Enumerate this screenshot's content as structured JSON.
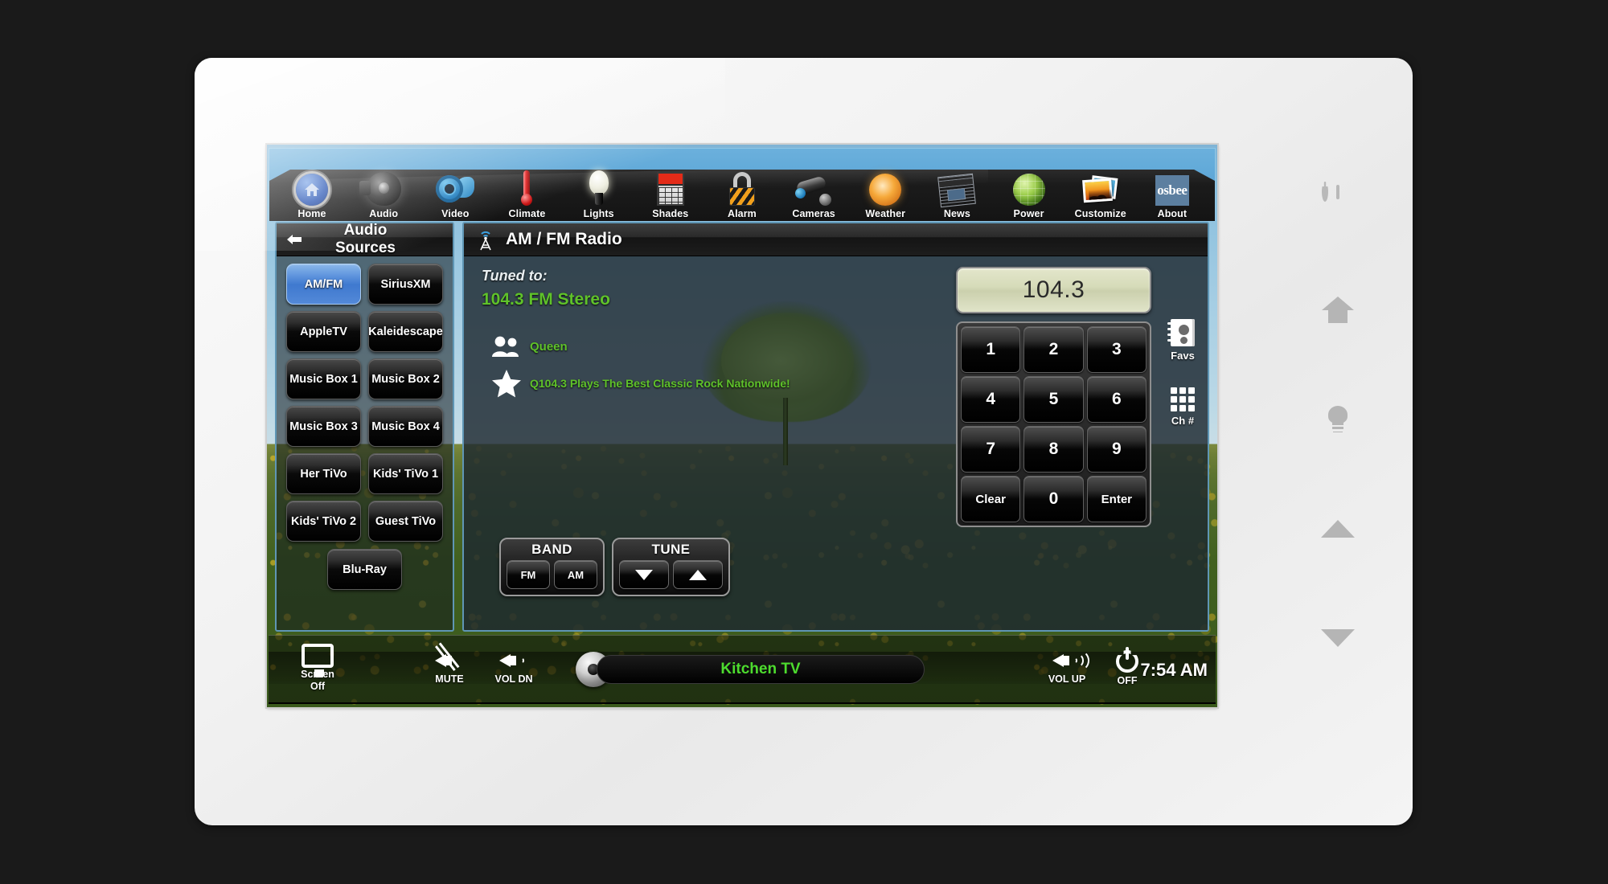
{
  "device": {
    "hardware_buttons": [
      {
        "name": "power",
        "icon": "power-icon"
      },
      {
        "name": "home",
        "icon": "home-icon"
      },
      {
        "name": "lights",
        "icon": "lightbulb-icon"
      },
      {
        "name": "up",
        "icon": "triangle-up-icon"
      },
      {
        "name": "down",
        "icon": "triangle-down-icon"
      }
    ]
  },
  "topnav": {
    "items": [
      {
        "label": "Home",
        "icon": "home-icon"
      },
      {
        "label": "Audio",
        "icon": "speaker-icon"
      },
      {
        "label": "Video",
        "icon": "film-reel-icon"
      },
      {
        "label": "Climate",
        "icon": "thermometer-icon"
      },
      {
        "label": "Lights",
        "icon": "lightbulb-icon"
      },
      {
        "label": "Shades",
        "icon": "window-shade-icon"
      },
      {
        "label": "Alarm",
        "icon": "padlock-icon"
      },
      {
        "label": "Cameras",
        "icon": "security-camera-icon"
      },
      {
        "label": "Weather",
        "icon": "sun-icon"
      },
      {
        "label": "News",
        "icon": "newspaper-icon"
      },
      {
        "label": "Power",
        "icon": "globe-icon"
      },
      {
        "label": "Customize",
        "icon": "photos-icon"
      },
      {
        "label": "About",
        "icon": "osbee-logo-icon"
      }
    ],
    "logo_text": "osbee"
  },
  "sidebar": {
    "title": "Audio Sources",
    "back_icon": "back-arrow-icon",
    "sources": [
      {
        "label": "AM/FM",
        "active": true
      },
      {
        "label": "SiriusXM",
        "active": false
      },
      {
        "label": "AppleTV",
        "active": false
      },
      {
        "label": "Kaleidescape",
        "active": false
      },
      {
        "label": "Music Box 1",
        "active": false
      },
      {
        "label": "Music Box 2",
        "active": false
      },
      {
        "label": "Music Box 3",
        "active": false
      },
      {
        "label": "Music Box 4",
        "active": false
      },
      {
        "label": "Her TiVo",
        "active": false
      },
      {
        "label": "Kids' TiVo 1",
        "active": false
      },
      {
        "label": "Kids' TiVo 2",
        "active": false
      },
      {
        "label": "Guest TiVo",
        "active": false
      },
      {
        "label": "Blu-Ray",
        "active": false
      }
    ]
  },
  "main": {
    "title": "AM / FM Radio",
    "title_icon": "radio-tower-icon",
    "tuned_label": "Tuned to:",
    "station": "104.3 FM Stereo",
    "artist": "Queen",
    "artist_icon": "people-icon",
    "slogan": "Q104.3 Plays The Best Classic Rock Nationwide!",
    "slogan_icon": "star-icon",
    "band": {
      "title": "BAND",
      "buttons": [
        "FM",
        "AM"
      ]
    },
    "tune": {
      "title": "TUNE",
      "buttons": [
        "tune-down-icon",
        "tune-up-icon"
      ]
    },
    "keypad": {
      "display": "104.3",
      "keys": [
        "1",
        "2",
        "3",
        "4",
        "5",
        "6",
        "7",
        "8",
        "9",
        "Clear",
        "0",
        "Enter"
      ]
    },
    "side_rail": [
      {
        "label": "Favs",
        "icon": "address-book-icon"
      },
      {
        "label": "Ch #",
        "icon": "keypad-grid-icon"
      }
    ]
  },
  "bottombar": {
    "screen_off_line1": "Screen",
    "screen_off_line2": "Off",
    "screen_off_icon": "monitor-icon",
    "mute_label": "MUTE",
    "mute_icon": "speaker-mute-icon",
    "vol_dn_label": "VOL DN",
    "vol_dn_icon": "speaker-low-icon",
    "vol_up_label": "VOL UP",
    "vol_up_icon": "speaker-high-icon",
    "off_label": "OFF",
    "off_icon": "power-icon",
    "zone": "Kitchen TV",
    "knob_icon": "volume-knob-icon",
    "clock": "7:54 AM"
  },
  "colors": {
    "accent_blue": "#4f86d6",
    "nav_sky": "#5fa8d8",
    "green_text": "#5fc22a",
    "ticker_green": "#4ddc2e",
    "display_bg": "#d6dbb9"
  }
}
